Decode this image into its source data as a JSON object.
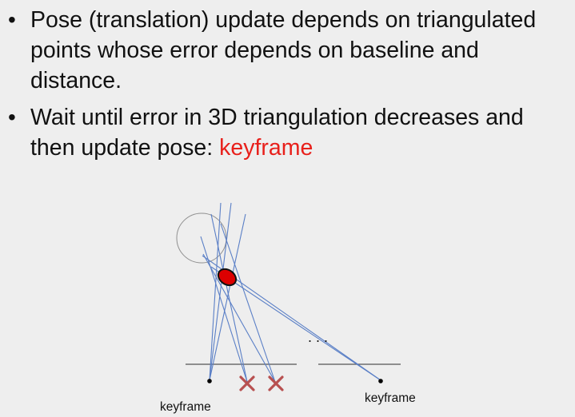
{
  "slide": {
    "bullets": [
      {
        "marker": "•",
        "text": "Pose (translation) update depends on triangulated points whose error depends on baseline and distance."
      },
      {
        "marker": "•",
        "text": "Wait until error in 3D triangulation decreases and then update pose: ",
        "highlight": "keyframe"
      }
    ]
  },
  "diagram": {
    "ellipsis": ". . .",
    "keyframe_left_label": "keyframe",
    "keyframe_right_label": "keyframe",
    "colors": {
      "ray": "#5a7fc6",
      "point_fill": "#dd0000",
      "reject_mark": "#b85050",
      "highlight_text": "#e8201b"
    }
  }
}
